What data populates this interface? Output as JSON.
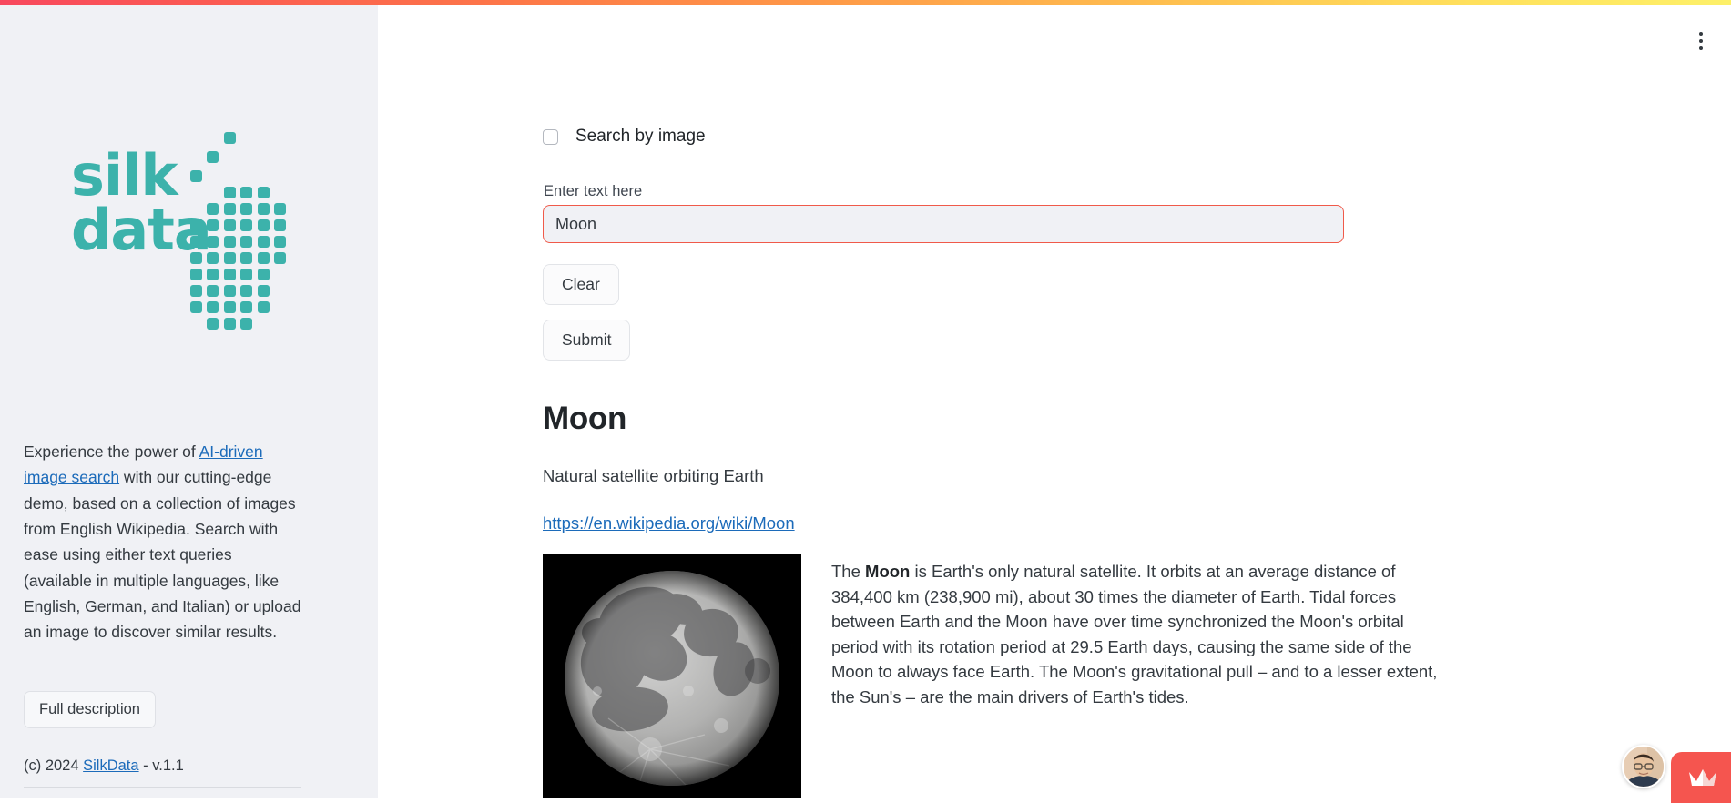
{
  "theme": {
    "accent_teal": "#3cb2ab",
    "link_blue": "#1c6bba",
    "input_border_red": "#f05a4a",
    "chat_widget_red": "#f5554f",
    "sidebar_bg": "#f0f1f5",
    "gradient_start": "#f8485e",
    "gradient_mid": "#fe9a48",
    "gradient_end": "#fdf069"
  },
  "sidebar": {
    "logo": {
      "line1": "silk",
      "line2": "data",
      "dots_icon_name": "silkdata-dot-matrix-logo"
    },
    "description": {
      "part1": "Experience the power of ",
      "link": "AI-driven image search",
      "part2": " with our cutting-edge demo, based on a collection of images from English Wikipedia. Search with ease using either text queries (available in multiple languages, like English, German, and Italian) or upload an image to discover similar results."
    },
    "full_description_button": "Full description",
    "footer": {
      "prefix": "(c) 2024 ",
      "link": "SilkData",
      "suffix": " - v.1.1"
    }
  },
  "main": {
    "kebab_menu_icon": "vertical-dots-icon",
    "search_by_image": {
      "label": "Search by image",
      "checked": false
    },
    "query": {
      "label": "Enter text here",
      "value": "Moon",
      "placeholder": "Enter text here"
    },
    "buttons": {
      "clear": "Clear",
      "submit": "Submit"
    },
    "result": {
      "title": "Moon",
      "subtitle": "Natural satellite orbiting Earth",
      "url": "https://en.wikipedia.org/wiki/Moon",
      "image_alt": "Full moon photograph on black background",
      "text_before_bold": "The ",
      "bold_term": "Moon",
      "text_after_bold": " is Earth's only natural satellite. It orbits at an average distance of 384,400 km (238,900 mi), about 30 times the diameter of Earth. Tidal forces between Earth and the Moon have over time synchronized the Moon's orbital period with its rotation period at 29.5 Earth days, causing the same side of the Moon to always face Earth. The Moon's gravitational pull – and to a lesser extent, the Sun's – are the main drivers of Earth's tides."
    }
  },
  "widgets": {
    "avatar_icon": "user-avatar-photo",
    "chat_icon": "crown-chat-launcher-icon"
  }
}
